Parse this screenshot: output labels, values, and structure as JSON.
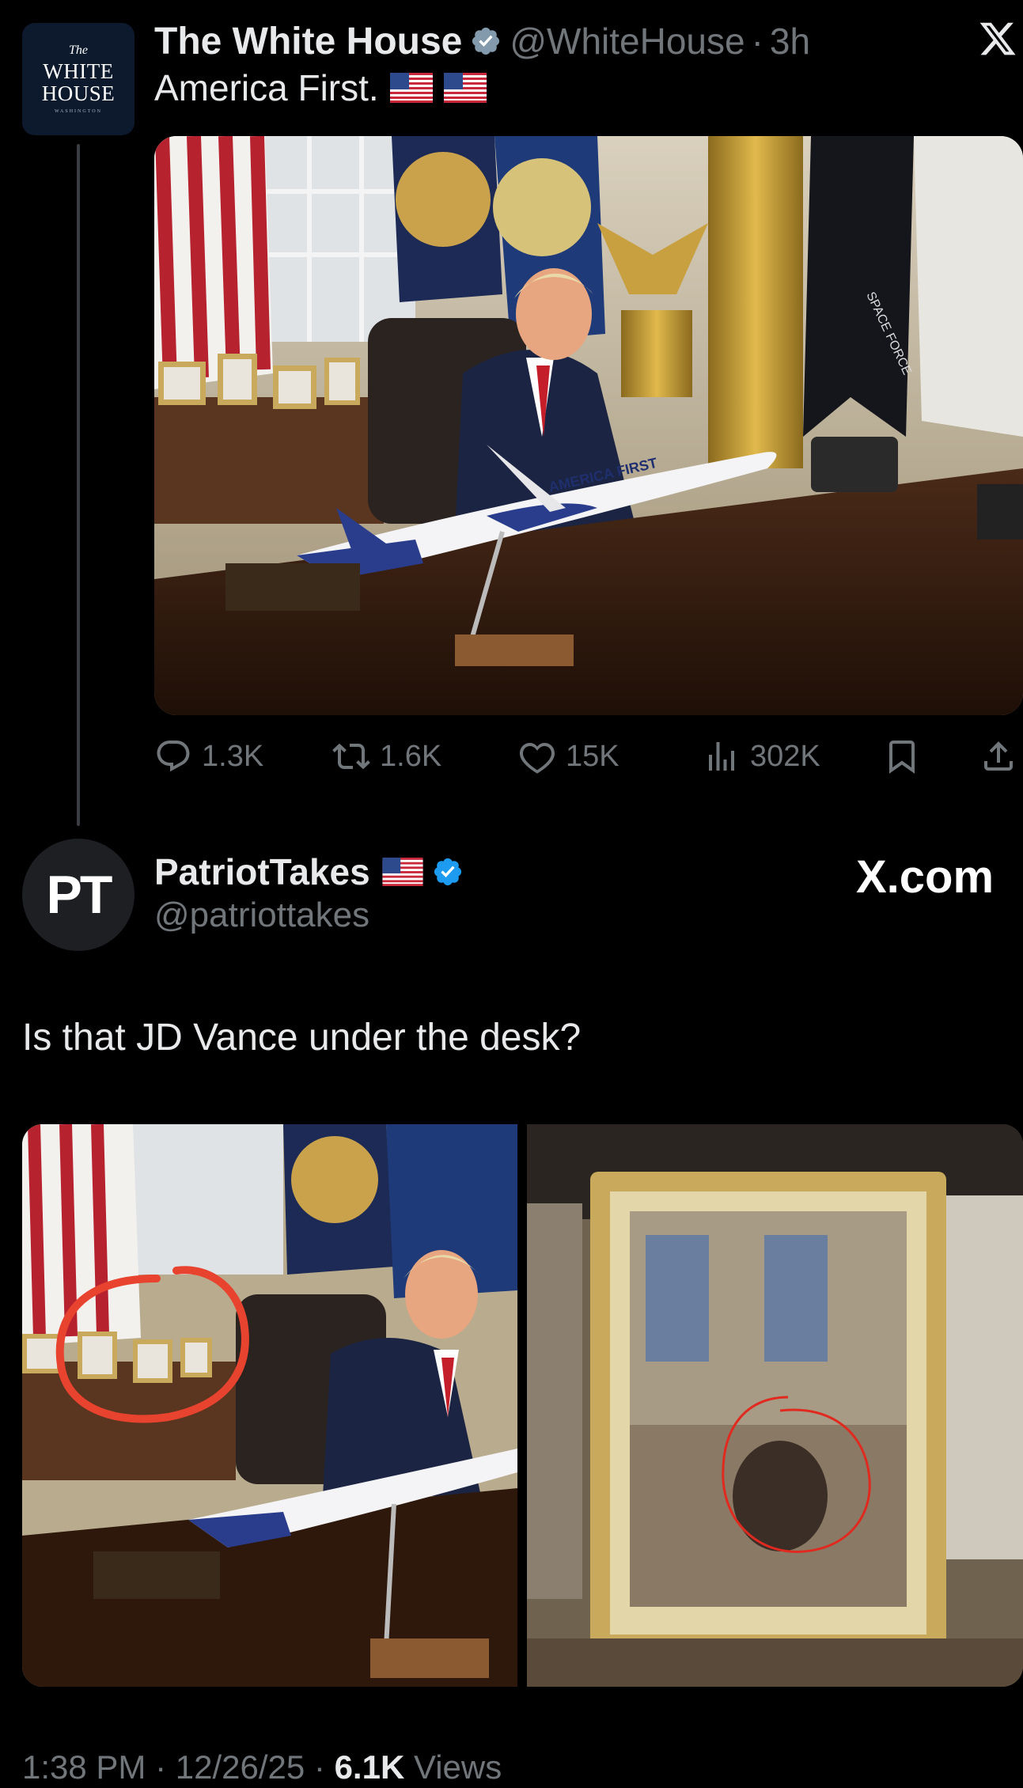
{
  "quoted_tweet": {
    "avatar": {
      "icon": "white-house-logo",
      "line1": "The",
      "line2": "WHITE",
      "line3": "HOUSE",
      "line4": "WASHINGTON"
    },
    "display_name": "The White House",
    "verified_icon": "verified-badge-gray",
    "handle": "@WhiteHouse",
    "separator": "·",
    "time": "3h",
    "text": "America First.",
    "emoji": [
      "us-flag-icon",
      "us-flag-icon"
    ],
    "image": {
      "description_icon": "oval-office-photo",
      "plane_label": "AMERICA FIRST",
      "flag_label": "SPACE FORCE"
    },
    "actions": {
      "replies": "1.3K",
      "reposts": "1.6K",
      "likes": "15K",
      "views": "302K"
    }
  },
  "main_tweet": {
    "avatar_text": "PT",
    "display_name": "PatriotTakes",
    "handle": "@patriottakes",
    "verified_icon": "verified-badge-blue",
    "watermark": "X.com",
    "text": "Is that JD Vance under the desk?",
    "meta": {
      "time": "1:38 PM",
      "date": "12/26/25",
      "views_count": "6.1K",
      "views_label": "Views"
    }
  },
  "colors": {
    "background": "#000000",
    "primary_text": "#e7e9ea",
    "secondary_text": "#71767b",
    "verified_blue": "#1d9bf0",
    "annotation_red": "#e8432e"
  }
}
